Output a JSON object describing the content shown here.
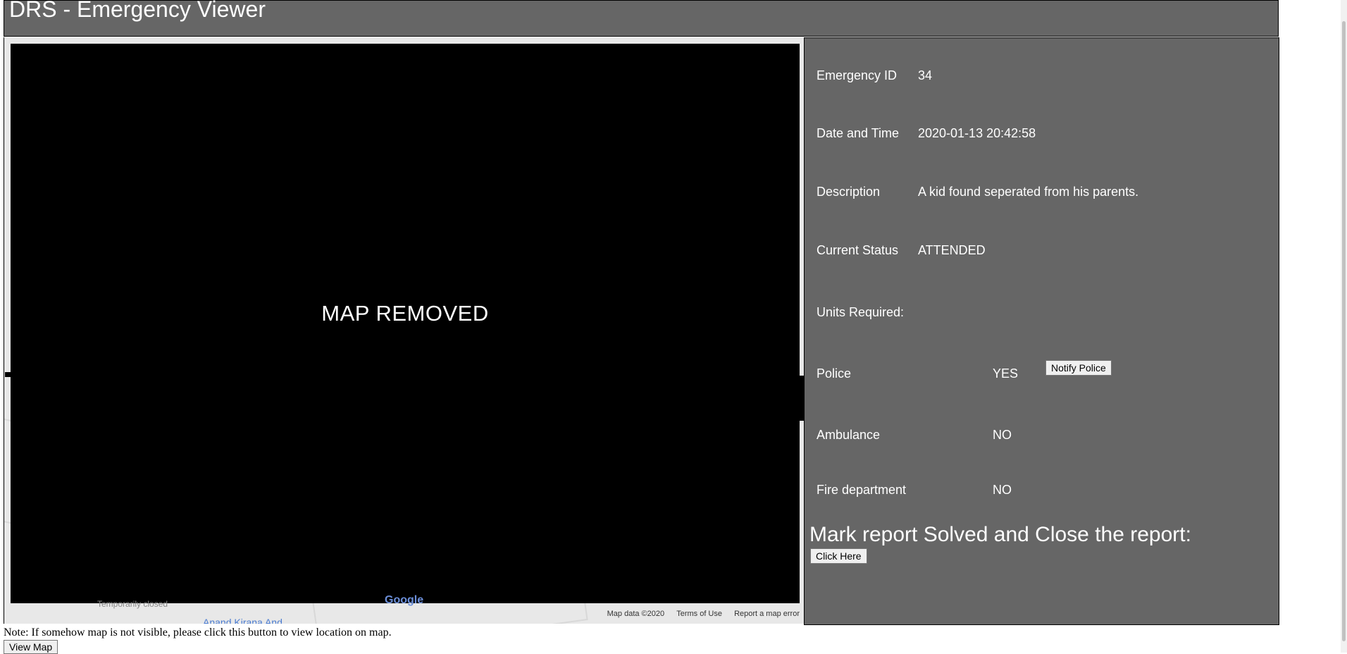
{
  "header": {
    "title": "DRS - Emergency Viewer"
  },
  "map": {
    "placeholder_text": "MAP REMOVED",
    "place_label": "Temporarily closed",
    "road_label": "Anand Kirana And...",
    "logo_text": "Google",
    "footer": {
      "data": "Map data ©2020",
      "terms": "Terms of Use",
      "report": "Report a map error"
    }
  },
  "details": {
    "emergency_id": {
      "label": "Emergency ID",
      "value": "34"
    },
    "date_time": {
      "label": "Date and Time",
      "value": "2020-01-13 20:42:58"
    },
    "description": {
      "label": "Description",
      "value": "A kid found seperated from his parents."
    },
    "status": {
      "label": "Current Status",
      "value": "ATTENDED"
    },
    "units_heading": "Units Required:",
    "units": [
      {
        "label": "Police",
        "value": "YES",
        "action": "Notify Police"
      },
      {
        "label": "Ambulance",
        "value": "NO"
      },
      {
        "label": "Fire department",
        "value": "NO"
      }
    ]
  },
  "close_section": {
    "heading": "Mark report Solved and Close the report:",
    "button": "Click Here"
  },
  "footer": {
    "note": "Note: If somehow map is not visible, please click this button to view location on map.",
    "view_map_button": "View Map"
  },
  "colors": {
    "header_bg": "#666666",
    "panel_bg": "#666666",
    "map_cover": "#000000"
  }
}
